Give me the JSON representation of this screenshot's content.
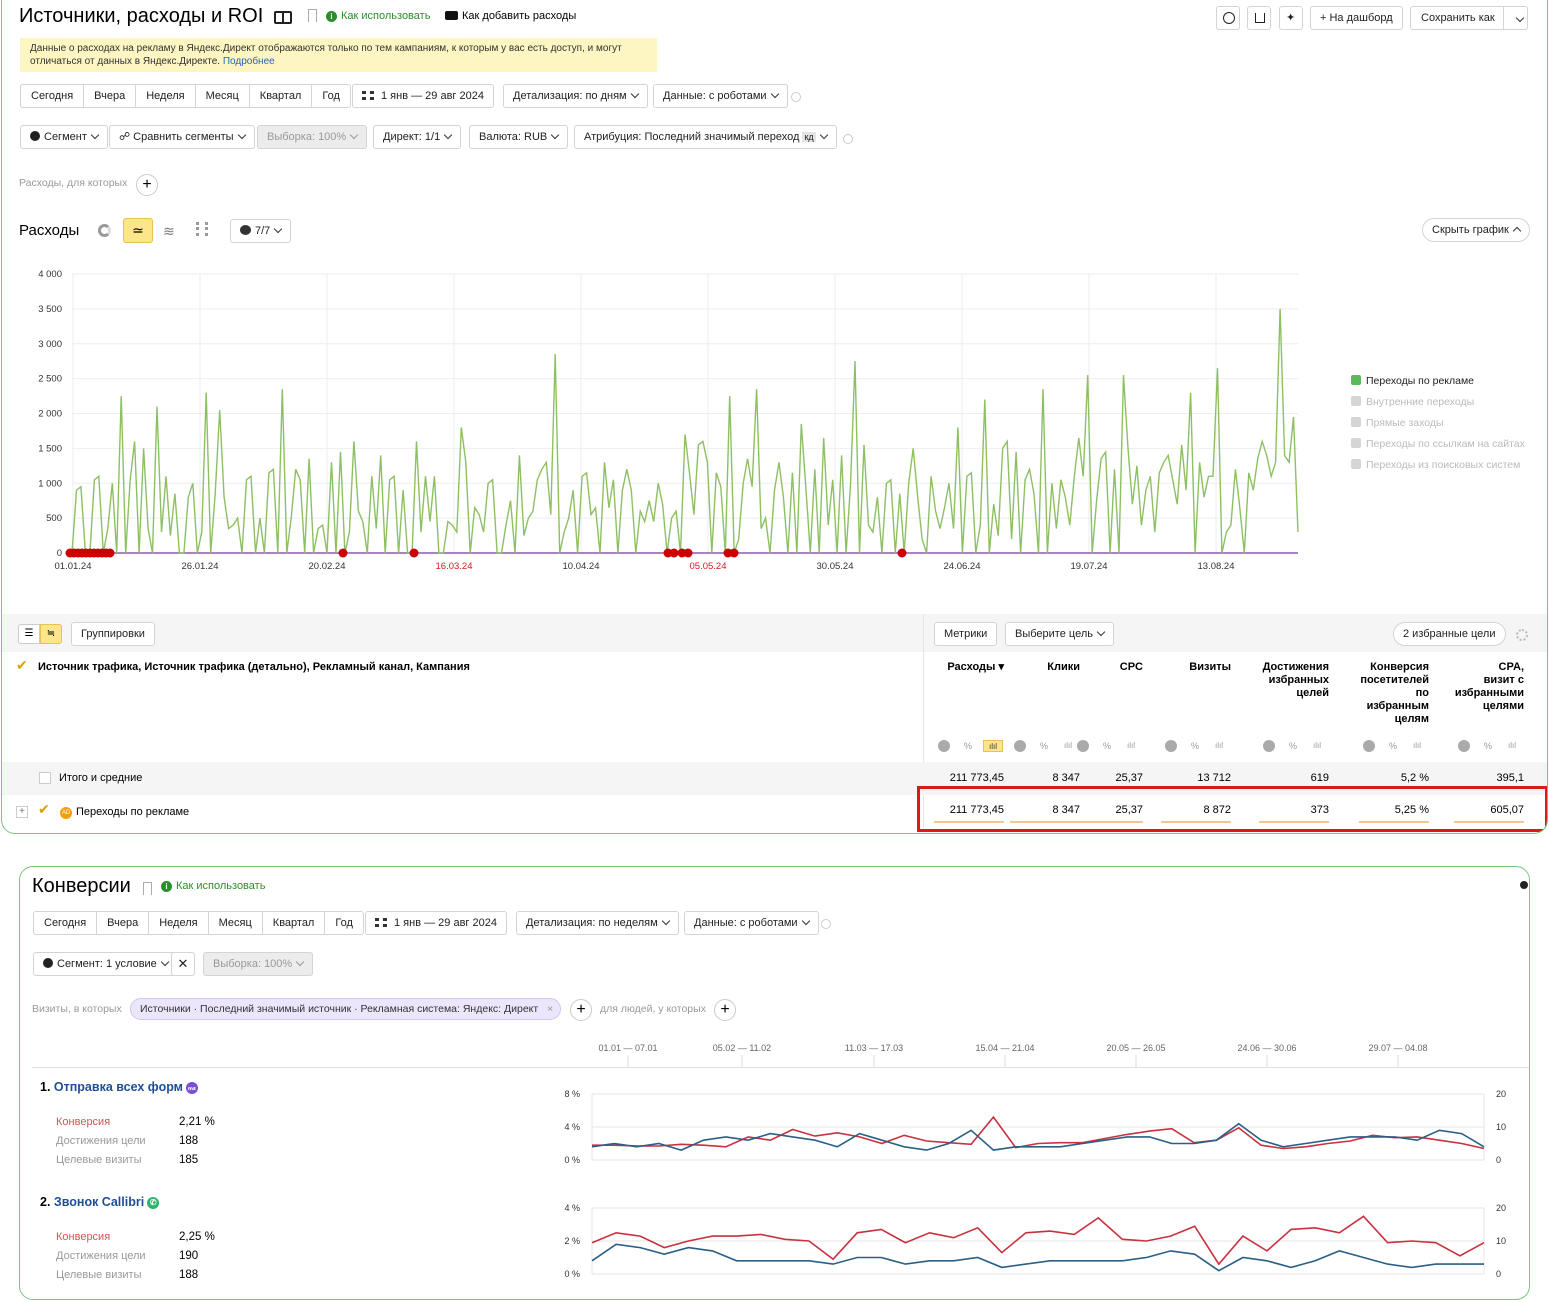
{
  "top": {
    "title": "Источники, расходы и ROI",
    "how_to_use": "Как использовать",
    "how_add_costs": "Как добавить расходы",
    "to_dashboard": "+ На дашборд",
    "save_as": "Сохранить как",
    "notice": "Данные о расходах на рекламу в Яндекс.Директ отображаются только по тем кампаниям, к которым у вас есть доступ, и могут отличаться от данных в Яндекс.Директе.",
    "notice_link": "Подробнее",
    "periods": [
      "Сегодня",
      "Вчера",
      "Неделя",
      "Месяц",
      "Квартал",
      "Год"
    ],
    "date_range": "1 янв — 29 авг 2024",
    "detail": "Детализация: по дням",
    "data_mode": "Данные: с роботами",
    "segment": "Сегмент",
    "compare": "Сравнить сегменты",
    "sample": "Выборка: 100%",
    "direct": "Директ: 1/1",
    "currency": "Валюта: RUB",
    "attribution": "Атрибуция: Последний значимый переход",
    "attribution_badge": "кд",
    "costs_filter": "Расходы, для которых",
    "chart_title": "Расходы",
    "metrics_count": "7/7",
    "hide_chart": "Скрыть график",
    "legend": [
      {
        "label": "Переходы по рекламе",
        "active": true
      },
      {
        "label": "Внутренние переходы",
        "active": false
      },
      {
        "label": "Прямые заходы",
        "active": false
      },
      {
        "label": "Переходы по ссылкам на сайтах",
        "active": false
      },
      {
        "label": "Переходы из поисковых систем",
        "active": false
      }
    ],
    "table": {
      "groupings": "Группировки",
      "metrics": "Метрики",
      "choose_goal": "Выберите цель",
      "fav_goals": "2 избранные цели",
      "dims": "Источник трафика, Источник трафика (детально), Рекламный канал, Кампания",
      "headers": [
        "Расходы ▾",
        "Клики",
        "CPC",
        "Визиты",
        "Достижения\nизбранных\nцелей",
        "Конверсия\nпосетителей\nпо\nизбранным\nцелям",
        "CPA,\nвизит с\nизбранными\nцелями"
      ],
      "totals_label": "Итого и средние",
      "totals": [
        "211 773,45",
        "8 347",
        "25,37",
        "13 712",
        "619",
        "5,2 %",
        "395,1"
      ],
      "row_label": "Переходы по рекламе",
      "row_badge": "AD",
      "row": [
        "211 773,45",
        "8 347",
        "25,37",
        "8 872",
        "373",
        "5,25 %",
        "605,07"
      ]
    }
  },
  "chart_data": [
    {
      "type": "line",
      "title": "Расходы",
      "y_ticks": [
        "4 000",
        "3 500",
        "3 000",
        "2 500",
        "2 000",
        "1 500",
        "1 000",
        "500",
        "0"
      ],
      "ylim": [
        0,
        4000
      ],
      "x_ticks": [
        "01.01.24",
        "26.01.24",
        "20.02.24",
        "16.03.24",
        "10.04.24",
        "05.05.24",
        "30.05.24",
        "24.06.24",
        "19.07.24",
        "13.08.24"
      ],
      "x_ticks_red": [
        "16.03.24",
        "05.05.24"
      ],
      "series": [
        {
          "name": "Переходы по рекламе",
          "color": "#8dc063",
          "values": [
            0,
            900,
            950,
            0,
            0,
            1050,
            1100,
            0,
            350,
            1000,
            0,
            2250,
            0,
            1050,
            1600,
            0,
            1500,
            350,
            0,
            2100,
            300,
            1100,
            250,
            850,
            0,
            0,
            800,
            1000,
            0,
            300,
            2300,
            0,
            850,
            2050,
            800,
            350,
            400,
            500,
            0,
            1050,
            1100,
            0,
            500,
            0,
            1150,
            1200,
            0,
            2350,
            0,
            500,
            1200,
            1050,
            0,
            1350,
            0,
            350,
            400,
            0,
            1300,
            0,
            1450,
            0,
            300,
            1600,
            600,
            450,
            0,
            1100,
            350,
            1400,
            0,
            1050,
            1100,
            0,
            900,
            0,
            0,
            1600,
            300,
            1100,
            450,
            1100,
            0,
            0,
            450,
            400,
            300,
            1800,
            1300,
            0,
            650,
            550,
            300,
            1000,
            1050,
            0,
            0,
            400,
            750,
            0,
            1400,
            250,
            500,
            600,
            1050,
            1200,
            1300,
            550,
            2850,
            0,
            300,
            500,
            900,
            0,
            1100,
            1150,
            550,
            650,
            0,
            1300,
            650,
            1050,
            0,
            900,
            1200,
            900,
            0,
            600,
            450,
            750,
            450,
            1000,
            700,
            0,
            500,
            600,
            0,
            1700,
            1150,
            550,
            1550,
            1600,
            1300,
            0,
            1150,
            950,
            0,
            2250,
            0,
            200,
            1000,
            1350,
            950,
            2350,
            350,
            500,
            0,
            900,
            1300,
            800,
            0,
            1150,
            0,
            1850,
            950,
            0,
            1200,
            0,
            1650,
            400,
            1050,
            0,
            1400,
            0,
            1000,
            2750,
            0,
            1550,
            400,
            300,
            800,
            0,
            1000,
            1050,
            0,
            850,
            0,
            1000,
            1500,
            800,
            200,
            0,
            1100,
            600,
            350,
            650,
            1000,
            350,
            1800,
            0,
            1100,
            1150,
            0,
            400,
            2200,
            0,
            700,
            250,
            1500,
            1600,
            200,
            1450,
            0,
            1050,
            1200,
            850,
            0,
            2350,
            0,
            1000,
            350,
            1050,
            800,
            400,
            1100,
            1650,
            1100,
            2550,
            0,
            750,
            1350,
            1450,
            0,
            1200,
            0,
            2550,
            1500,
            700,
            1250,
            400,
            900,
            1100,
            300,
            1150,
            1300,
            1400,
            1050,
            700,
            1550,
            900,
            2300,
            0,
            1300,
            800,
            1100,
            1100,
            2650,
            0,
            300,
            400,
            1200,
            650,
            0,
            1150,
            900,
            1350,
            1600,
            1400,
            1100,
            1300,
            3500,
            1400,
            1300,
            1950,
            300
          ]
        }
      ]
    },
    {
      "type": "line",
      "title": "Отправка всех форм",
      "x_ticks": [
        "01.01 — 07.01",
        "05.02 — 11.02",
        "11.03 — 17.03",
        "15.04 — 21.04",
        "20.05 — 26.05",
        "24.06 — 30.06",
        "29.07 — 04.08"
      ],
      "y_ticks_left": [
        "8 %",
        "4 %",
        "0 %"
      ],
      "y_ticks_right": [
        "20",
        "10",
        "0"
      ],
      "ylim_left": [
        0,
        8
      ],
      "ylim_right": [
        0,
        20
      ],
      "series": [
        {
          "name": "Конверсия",
          "color": "#c8313e",
          "axis": "left",
          "values": [
            1.8,
            1.8,
            1.7,
            1.7,
            1.9,
            1.8,
            1.6,
            2.8,
            2.4,
            3.7,
            2.9,
            3.3,
            2.8,
            2.0,
            3.0,
            2.3,
            2.1,
            1.9,
            5.2,
            1.5,
            2.0,
            2.1,
            2.1,
            2.6,
            3.1,
            3.5,
            3.8,
            2.1,
            2.4,
            3.9,
            1.8,
            1.4,
            1.6,
            2.0,
            2.3,
            3.0,
            2.7,
            2.8,
            2.4,
            2.0,
            1.4
          ]
        },
        {
          "name": "Целевые визиты",
          "color": "#2a5f86",
          "axis": "right",
          "values": [
            4,
            5,
            4,
            5,
            3,
            6,
            7,
            6,
            8,
            7,
            6,
            4,
            8,
            6,
            4,
            3,
            5,
            9,
            3,
            4,
            4,
            4,
            5,
            6,
            7,
            7,
            5,
            5,
            6,
            11,
            6,
            4,
            5,
            6,
            7,
            7,
            7,
            6,
            9,
            8,
            4
          ]
        }
      ]
    },
    {
      "type": "line",
      "title": "Звонок Callibri",
      "y_ticks_left": [
        "4 %",
        "2 %",
        "0 %"
      ],
      "y_ticks_right": [
        "20",
        "10",
        "0"
      ],
      "ylim_left": [
        0,
        4
      ],
      "ylim_right": [
        0,
        20
      ],
      "series": [
        {
          "name": "Конверсия",
          "color": "#c8313e",
          "axis": "left",
          "values": [
            1.9,
            2.5,
            2.3,
            1.6,
            2.0,
            2.3,
            2.3,
            2.4,
            2.1,
            2.0,
            0.9,
            2.5,
            2.7,
            1.9,
            2.5,
            2.2,
            2.8,
            1.3,
            2.5,
            2.6,
            2.4,
            3.4,
            2.1,
            2.0,
            2.3,
            2.9,
            0.6,
            2.3,
            1.4,
            2.7,
            2.8,
            2.5,
            3.5,
            1.9,
            2.0,
            1.9,
            1.1,
            1.9
          ]
        },
        {
          "name": "Целевые визиты",
          "color": "#2a5f86",
          "axis": "right",
          "values": [
            4,
            9,
            8,
            6,
            8,
            7,
            4,
            4,
            4,
            4,
            3,
            5,
            5,
            3,
            4,
            4,
            5,
            2,
            3,
            4,
            4,
            4,
            4,
            5,
            7,
            6,
            1,
            5,
            4,
            2,
            4,
            7,
            5,
            3,
            2,
            3,
            3,
            3
          ]
        }
      ]
    }
  ],
  "bottom": {
    "title": "Конверсии",
    "how_to_use": "Как использовать",
    "periods": [
      "Сегодня",
      "Вчера",
      "Неделя",
      "Месяц",
      "Квартал",
      "Год"
    ],
    "date_range": "1 янв — 29 авг 2024",
    "detail": "Детализация: по неделям",
    "data_mode": "Данные: с роботами",
    "segment": "Сегмент: 1 условие",
    "sample": "Выборка: 100%",
    "visits_label": "Визиты, в которых",
    "filter_chip": "Источники · Последний значимый источник · Рекламная система: Яндекс: Директ",
    "people_label": "для людей, у которых",
    "goals": [
      {
        "num": "1.",
        "name": "Отправка всех форм",
        "badge": "ₘₛ",
        "metrics": [
          {
            "label": "Конверсия",
            "value": "2,21 %"
          },
          {
            "label": "Достижения цели",
            "value": "188"
          },
          {
            "label": "Целевые визиты",
            "value": "185"
          }
        ]
      },
      {
        "num": "2.",
        "name": "Звонок Callibri",
        "badge": "✆",
        "metrics": [
          {
            "label": "Конверсия",
            "value": "2,25 %"
          },
          {
            "label": "Достижения цели",
            "value": "190"
          },
          {
            "label": "Целевые визиты",
            "value": "188"
          }
        ]
      }
    ]
  }
}
